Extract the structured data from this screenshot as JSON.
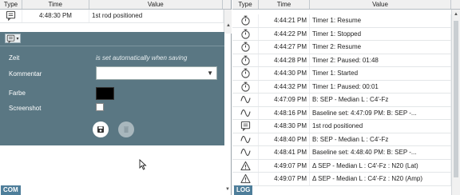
{
  "left_pane": {
    "columns": [
      "Type",
      "Time",
      "Value"
    ],
    "rows": [
      {
        "icon": "comment-icon",
        "time": "4:48:30 PM",
        "value": "1st rod positioned"
      }
    ],
    "panel": {
      "fields": {
        "zeit_label": "Zeit",
        "zeit_note": "is set automatically when saving",
        "kommentar_label": "Kommentar",
        "farbe_label": "Farbe",
        "screenshot_label": "Screenshot"
      },
      "color_value": "#000000"
    },
    "badge": "COM"
  },
  "right_pane": {
    "columns": [
      "Type",
      "Time",
      "Value"
    ],
    "rows": [
      {
        "icon": "stopwatch-icon",
        "time": "4:44:21 PM",
        "value": "Timer 1: Resume"
      },
      {
        "icon": "stopwatch-icon",
        "time": "4:44:22 PM",
        "value": "Timer 1: Stopped"
      },
      {
        "icon": "stopwatch-icon",
        "time": "4:44:27 PM",
        "value": "Timer 2: Resume"
      },
      {
        "icon": "stopwatch-icon",
        "time": "4:44:28 PM",
        "value": "Timer 2: Paused:  01:48"
      },
      {
        "icon": "stopwatch-icon",
        "time": "4:44:30 PM",
        "value": "Timer 1: Started"
      },
      {
        "icon": "stopwatch-icon",
        "time": "4:44:32 PM",
        "value": "Timer 1: Paused:  00:01"
      },
      {
        "icon": "waveform-icon",
        "time": "4:47:09 PM",
        "value": "B: SEP - Median L : C4'-Fz"
      },
      {
        "icon": "waveform-icon",
        "time": "4:48:16 PM",
        "value": "Baseline set: 4:47:09 PM: B: SEP -..."
      },
      {
        "icon": "comment-icon",
        "time": "4:48:30 PM",
        "value": "1st rod positioned"
      },
      {
        "icon": "waveform-icon",
        "time": "4:48:40 PM",
        "value": "B: SEP - Median L : C4'-Fz"
      },
      {
        "icon": "waveform-icon",
        "time": "4:48:41 PM",
        "value": "Baseline set: 4:48:40 PM: B: SEP -..."
      },
      {
        "icon": "warning-icon",
        "time": "4:49:07 PM",
        "value": "Δ SEP - Median L : C4'-Fz : N20 (Lat)"
      },
      {
        "icon": "warning-icon",
        "time": "4:49:07 PM",
        "value": "Δ SEP - Median L : C4'-Fz : N20 (Amp)"
      }
    ],
    "badge": "LOG"
  },
  "colors": {
    "panel_bg": "#5a7783",
    "badge_bg": "#4e7e9a"
  }
}
